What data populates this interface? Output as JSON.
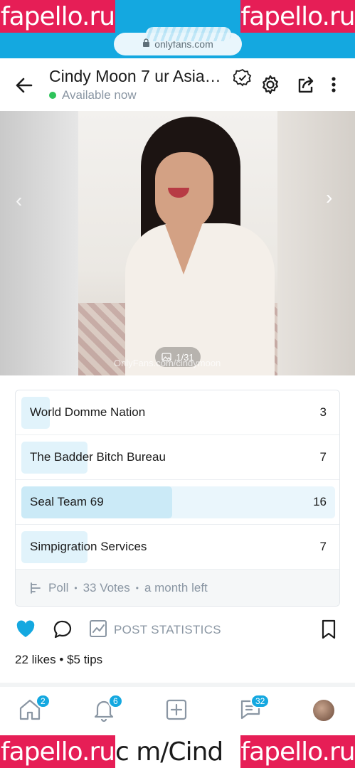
{
  "watermark": {
    "text": "fapello.ru",
    "color": "#e61e56"
  },
  "browser": {
    "url": "onlyfans.com",
    "accent": "#14a8e0"
  },
  "header": {
    "title": "Cindy Moon 7 ur Asia…",
    "status": "Available now",
    "status_color": "#2ec35a"
  },
  "media": {
    "counter": "1/31",
    "watermark_text": "OnlyFans.com/cindymoon"
  },
  "poll": {
    "options": [
      {
        "label": "World Domme Nation",
        "votes": "3",
        "share": 0.09
      },
      {
        "label": "The Badder Bitch Bureau",
        "votes": "7",
        "share": 0.21
      },
      {
        "label": "Seal Team 69",
        "votes": "16",
        "share": 0.48,
        "selected": true
      },
      {
        "label": "Simpigration Services",
        "votes": "7",
        "share": 0.21
      }
    ],
    "footer": {
      "type": "Poll",
      "votes": "33 Votes",
      "time_left": "a month left"
    }
  },
  "actions": {
    "post_statistics": "POST STATISTICS",
    "likes": "22 likes",
    "tips": "$5 tips",
    "like_color": "#14a8e0"
  },
  "nav": {
    "home_badge": "2",
    "notifications_badge": "6",
    "messages_badge": "32"
  },
  "bottom_url": "c m/Cind"
}
